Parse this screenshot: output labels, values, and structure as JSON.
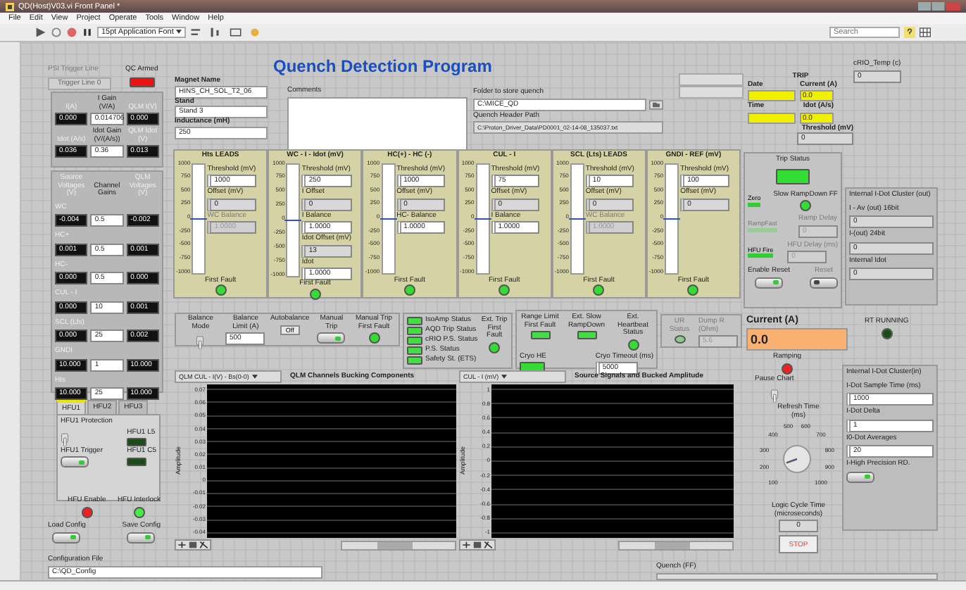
{
  "window": {
    "title": "QD(Host)V03.vi Front Panel *"
  },
  "menu": [
    "File",
    "Edit",
    "View",
    "Project",
    "Operate",
    "Tools",
    "Window",
    "Help"
  ],
  "toolbar": {
    "font": "15pt Application Font",
    "search_placeholder": "Search"
  },
  "title": "Quench Detection Program",
  "psi_trigger": {
    "label": "PSI Trigger Line",
    "value": "Trigger Line 0",
    "disabled": true
  },
  "qc_armed": {
    "label": "QC Armed",
    "on": true,
    "color": "#ee1111"
  },
  "current_box": [
    {
      "labels": [
        "I(A)",
        "I Gain (V/A)",
        "QLM I(V)"
      ],
      "values": [
        "0.000",
        "0.014706",
        "0.000"
      ]
    },
    {
      "labels": [
        "Idot (A/s)",
        "Idot Gain (V/(A/s))",
        "QLM Idot (V)"
      ],
      "values": [
        "0.036",
        "0.36",
        "0.013"
      ]
    }
  ],
  "voltage_box": {
    "headers": [
      "Source Voltages (V)",
      "Channel Gains",
      "QLM Voltages (V)"
    ],
    "rows": [
      {
        "name": "WC",
        "source": "-0.004",
        "gain": "0.5",
        "qlm": "-0.002"
      },
      {
        "name": "HC+",
        "source": "0.001",
        "gain": "0.5",
        "qlm": "0.001"
      },
      {
        "name": "HC-",
        "source": "0.000",
        "gain": "0.5",
        "qlm": "0.000"
      },
      {
        "name": "CUL - I",
        "source": "0.000",
        "gain": "10",
        "qlm": "0.001"
      },
      {
        "name": "SCL (Lts)",
        "source": "0.000",
        "gain": "25",
        "qlm": "0.002"
      },
      {
        "name": "GNDI",
        "source": "10.000",
        "gain": "1",
        "qlm": "10.000"
      },
      {
        "name": "Hts",
        "source": "10.000",
        "gain": "25",
        "qlm": "10.000"
      }
    ]
  },
  "magnet": [
    {
      "label": "Magnet Name",
      "value": "HINS_CH_SOL_T2_06"
    },
    {
      "label": "Stand",
      "value": "Stand 3"
    },
    {
      "label": "Inductance (mH)",
      "value": "250"
    }
  ],
  "comments": {
    "label": "Comments"
  },
  "folder": {
    "label": "Folder to store quench",
    "value": "C:\\MICE_QD"
  },
  "header_path": {
    "label": "Quench Header Path",
    "value": "C:\\Proton_Driver_Data\\PD0001_02-14-08_135037.txt"
  },
  "trip": {
    "title": "TRIP",
    "date_label": "Date",
    "time_label": "Time",
    "current_label": "Current (A)",
    "current": "0.0",
    "idot_label": "Idot (A/s)",
    "idot": "0.0",
    "threshold_label": "Threshold (mV)",
    "threshold": "0"
  },
  "crio_temp": {
    "label": "cRIO_Temp (c)",
    "value": "0"
  },
  "channels": [
    {
      "name": "Hts LEADS",
      "level": 0.5,
      "ticks": [
        "1000",
        "750",
        "500",
        "250",
        "0",
        "-250",
        "-500",
        "-750",
        "-1000"
      ],
      "fault_label": "First Fault",
      "fault": true,
      "fields": [
        {
          "label": "Threshold (mV)",
          "value": "1000",
          "kind": "control",
          "disabled": false
        },
        {
          "label": "Offset (mV)",
          "value": "0",
          "kind": "indicator",
          "disabled": false
        },
        {
          "label": "WC Balance",
          "value": "1.0000",
          "kind": "indicator",
          "disabled": true
        }
      ]
    },
    {
      "name": "WC - I - Idot (mV)",
      "level": 0.5,
      "ticks": [
        "1000",
        "750",
        "500",
        "250",
        "0",
        "-250",
        "-500",
        "-750",
        "-1000"
      ],
      "fault_label": "First Fault",
      "fault": true,
      "fields": [
        {
          "label": "Threshold (mV)",
          "value": "250",
          "kind": "control",
          "disabled": false
        },
        {
          "label": "I Offset",
          "value": "0",
          "kind": "indicator",
          "disabled": false
        },
        {
          "label": "I Balance",
          "value": "1.0000",
          "kind": "control",
          "disabled": false
        },
        {
          "label": "Idot Offset (mV)",
          "value": "13",
          "kind": "indicator",
          "disabled": false
        },
        {
          "label": "Idot",
          "value": "1.0000",
          "kind": "control",
          "disabled": false
        }
      ]
    },
    {
      "name": "HC(+) - HC (-)",
      "level": 0.5,
      "ticks": [
        "1000",
        "750",
        "500",
        "250",
        "0",
        "-250",
        "-500",
        "-750",
        "-1000"
      ],
      "fault_label": "First Fault",
      "fault": true,
      "fields": [
        {
          "label": "Threshold (mV)",
          "value": "1000",
          "kind": "control",
          "disabled": false
        },
        {
          "label": "Offset (mV)",
          "value": "0",
          "kind": "indicator",
          "disabled": false
        },
        {
          "label": "HC- Balance",
          "value": "1.0000",
          "kind": "control",
          "disabled": false
        }
      ]
    },
    {
      "name": "CUL - I",
      "level": 0.5,
      "ticks": [
        "1000",
        "750",
        "500",
        "250",
        "0",
        "-250",
        "-500",
        "-750",
        "-1000"
      ],
      "fault_label": "First Fault",
      "fault": true,
      "fields": [
        {
          "label": "Threshold (mV)",
          "value": "75",
          "kind": "control",
          "disabled": false
        },
        {
          "label": "Offset (mV)",
          "value": "0",
          "kind": "indicator",
          "disabled": false
        },
        {
          "label": "I Balance",
          "value": "1.0000",
          "kind": "control",
          "disabled": false
        }
      ]
    },
    {
      "name": "SCL (Lts) LEADS",
      "level": 0.5,
      "ticks": [
        "1000",
        "750",
        "500",
        "250",
        "0",
        "-250",
        "-500",
        "-750",
        "-1000"
      ],
      "fault_label": "First Fault",
      "fault": true,
      "fields": [
        {
          "label": "Threshold (mV)",
          "value": "10",
          "kind": "control",
          "disabled": false
        },
        {
          "label": "Offset (mV)",
          "value": "0",
          "kind": "indicator",
          "disabled": false
        },
        {
          "label": "WC Balance",
          "value": "1.0000",
          "kind": "indicator",
          "disabled": true
        }
      ]
    },
    {
      "name": "GNDI - REF (mV)",
      "level": 0.5,
      "ticks": [
        "1000",
        "750",
        "500",
        "250",
        "0",
        "-250",
        "-500",
        "-750",
        "-1000"
      ],
      "fault_label": "First Fault",
      "fault": true,
      "fields": [
        {
          "label": "Threshold (mV)",
          "value": "100",
          "kind": "control",
          "disabled": false
        },
        {
          "label": "Offset (mV)",
          "value": "0",
          "kind": "indicator",
          "disabled": false
        }
      ]
    }
  ],
  "trip_status": {
    "label": "Trip Status",
    "on": true,
    "zero": "Zero",
    "slow_label": "Slow RampDown FF",
    "slow_on": true,
    "rampfast": "RampFast",
    "ramp_delay_label": "Ramp Delay",
    "ramp_delay": "0",
    "hfu_fire": "HFU Fire",
    "hfu_delay_label": "HFU Delay (ms)",
    "hfu_delay": "0",
    "enable_reset": "Enable Reset",
    "enable_reset_on": true,
    "reset": "Reset",
    "reset_on": false
  },
  "idot_out": {
    "title": "Internal I-Dot Cluster (out)",
    "fields": [
      {
        "label": "I - Av (out) 16bit",
        "value": "0"
      },
      {
        "label": "I-(out) 24bit",
        "value": "0"
      },
      {
        "label": "Internal Idot",
        "value": "0"
      }
    ]
  },
  "balance": {
    "mode_label": "Balance Mode",
    "mode_on": false,
    "limit_label": "Balance Limit (A)",
    "limit": "500",
    "auto_label": "Autobalance",
    "auto": "Off",
    "manual_label": "Manual Trip",
    "manual_on": true,
    "manual_ff_label": "Manual Trip First Fault",
    "manual_ff": true
  },
  "statuses": [
    {
      "label": "IsoAmp Status",
      "on": true
    },
    {
      "label": "AQD Trip Status",
      "on": true
    },
    {
      "label": "cRIO P.S. Status",
      "on": true
    },
    {
      "label": "P.S. Status",
      "on": true
    },
    {
      "label": "Safety St. (ETS)",
      "on": true
    }
  ],
  "ext_trip": {
    "label": "Ext. Trip First Fault",
    "on": true
  },
  "range": {
    "limit_label": "Range Limit First Fault",
    "limit_on": true,
    "slow_label": "Ext. Slow RampDown",
    "slow_on": true,
    "heartbeat_label": "Ext. Heartbeat Status",
    "heartbeat_on": true,
    "cryo_label": "Cryo HE",
    "cryo_on": true,
    "timeout_label": "Cryo Timeout (ms)",
    "timeout": "5000"
  },
  "ur": {
    "label": "UR Status",
    "on": true,
    "dump_label": "Dump R (Ohm)",
    "dump": "5.6"
  },
  "current": {
    "label": "Current (A)",
    "value": "0.0"
  },
  "rt_running": {
    "label": "RT RUNNING",
    "on": false
  },
  "ramping": {
    "label": "Ramping",
    "on": true
  },
  "pause": {
    "label": "Pause Chart",
    "on": false
  },
  "refresh": {
    "label": "Refresh Time (ms)",
    "ticks": [
      "100",
      "200",
      "300",
      "400",
      "500",
      "600",
      "700",
      "800",
      "900",
      "1000"
    ]
  },
  "logic": {
    "label": "Logic Cycle Time (microseconds)",
    "value": "0"
  },
  "stop": "STOP",
  "idot_in": {
    "title": "Internal I-Dot Cluster(in)",
    "fields": [
      {
        "label": "I-Dot Sample Time (ms)",
        "value": "1000"
      },
      {
        "label": "I-Dot Delta",
        "value": "1"
      },
      {
        "label": "I0-Dot Averages",
        "value": "20"
      }
    ],
    "hp_label": "I-High Precision RD.",
    "hp_on": true
  },
  "charts": [
    {
      "selector": "QLM CUL - I(V) - Bs(0-0)",
      "title": "QLM Channels Bucking Components",
      "ylabel": "Amplitude",
      "yticks": [
        "0.07",
        "0.06",
        "0.05",
        "0.04",
        "0.03",
        "0.02",
        "0.01",
        "0",
        "-0.01",
        "-0.02",
        "-0.03",
        "-0.04"
      ]
    },
    {
      "selector": "CUL - I (mV)",
      "title": "Source Signals and Bucked Amplitude",
      "ylabel": "Amplitude",
      "yticks": [
        "1",
        "0.8",
        "0.6",
        "0.4",
        "0.2",
        "0",
        "-0.2",
        "-0.4",
        "-0.6",
        "-0.8",
        "-1"
      ]
    }
  ],
  "hfu": {
    "tabs": [
      {
        "label": "HFU1",
        "selected": true
      },
      {
        "label": "HFU2",
        "selected": false
      },
      {
        "label": "HFU3",
        "selected": false
      }
    ],
    "protection_label": "HFU1 Protection",
    "protection_on": false,
    "trigger_label": "HFU1 Trigger",
    "trigger_on": true,
    "l5_label": "HFU1 L5",
    "l5_on": false,
    "c5_label": "HFU1 C5",
    "c5_on": false
  },
  "hfu_enable": {
    "label": "HFU Enable",
    "on": true
  },
  "hfu_interlock": {
    "label": "HFU Interlock",
    "on": true
  },
  "config": {
    "load": "Load Config",
    "load_on": true,
    "save": "Save Config",
    "save_on": true,
    "file_label": "Configuration File",
    "file": "C:\\QD_Config"
  },
  "quench": {
    "label": "Quench (FF)"
  }
}
